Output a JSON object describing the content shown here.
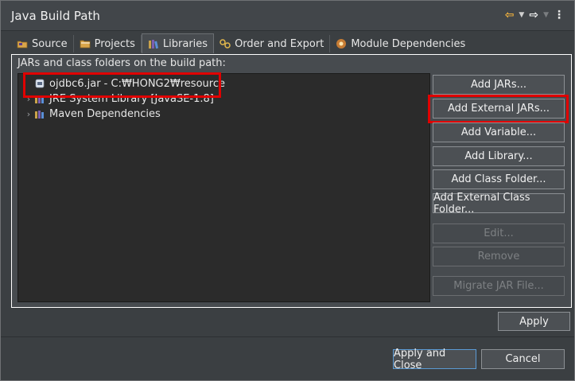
{
  "window": {
    "title": "Java Build Path"
  },
  "tabs": [
    {
      "label": "Source",
      "icon": "source-folder-icon",
      "active": false
    },
    {
      "label": "Projects",
      "icon": "projects-icon",
      "active": false
    },
    {
      "label": "Libraries",
      "icon": "libraries-icon",
      "active": true
    },
    {
      "label": "Order and Export",
      "icon": "order-export-icon",
      "active": false
    },
    {
      "label": "Module Dependencies",
      "icon": "module-icon",
      "active": false
    }
  ],
  "panel": {
    "label": "JARs and class folders on the build path:"
  },
  "tree": [
    {
      "label": "ojdbc6.jar - C:₩HONG2₩resource",
      "icon": "jar-icon",
      "expandable": false
    },
    {
      "label": "JRE System Library [JavaSE-1.8]",
      "icon": "library-icon",
      "expandable": true
    },
    {
      "label": "Maven Dependencies",
      "icon": "library-icon",
      "expandable": true
    }
  ],
  "buttons": {
    "add_jars": "Add JARs...",
    "add_external_jars": "Add External JARs...",
    "add_variable": "Add Variable...",
    "add_library": "Add Library...",
    "add_class_folder": "Add Class Folder...",
    "add_external_class_folder": "Add External Class Folder...",
    "edit": "Edit...",
    "remove": "Remove",
    "migrate_jar": "Migrate JAR File...",
    "apply": "Apply",
    "apply_and_close": "Apply and Close",
    "cancel": "Cancel"
  },
  "colors": {
    "highlight": "#e00000",
    "accent": "#f2b33d",
    "focus": "#5b9bd5"
  }
}
